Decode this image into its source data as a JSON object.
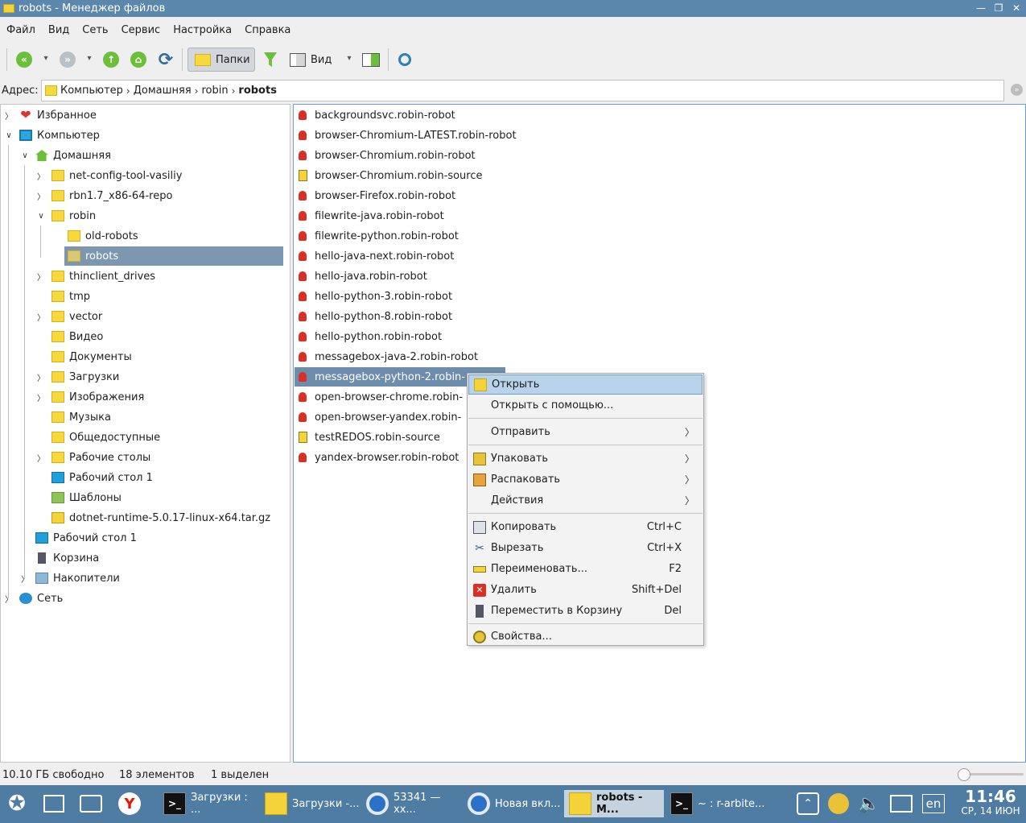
{
  "window": {
    "title": "robots - Менеджер файлов"
  },
  "menubar": [
    "Файл",
    "Вид",
    "Сеть",
    "Сервис",
    "Настройка",
    "Справка"
  ],
  "toolbar": {
    "folders_label": "Папки",
    "view_label": "Вид"
  },
  "address": {
    "label": "Адрес:",
    "crumbs": [
      "Компьютер",
      "Домашняя",
      "robin",
      "robots"
    ]
  },
  "tree": {
    "items": [
      {
        "label": "Избранное",
        "icon": "heart-icon"
      },
      {
        "label": "Компьютер",
        "icon": "monitor-icon"
      },
      {
        "label": "Домашняя",
        "icon": "home-icon"
      },
      {
        "label": "net-config-tool-vasiliy",
        "icon": "folder-icon"
      },
      {
        "label": "rbn1.7_x86-64-repo",
        "icon": "folder-icon"
      },
      {
        "label": "robin",
        "icon": "folder-icon"
      },
      {
        "label": "old-robots",
        "icon": "folder-icon"
      },
      {
        "label": "robots",
        "icon": "folder-icon"
      },
      {
        "label": "thinclient_drives",
        "icon": "folder-icon"
      },
      {
        "label": "tmp",
        "icon": "folder-icon"
      },
      {
        "label": "vector",
        "icon": "folder-icon"
      },
      {
        "label": "Видео",
        "icon": "video-folder-icon"
      },
      {
        "label": "Документы",
        "icon": "documents-folder-icon"
      },
      {
        "label": "Загрузки",
        "icon": "downloads-folder-icon"
      },
      {
        "label": "Изображения",
        "icon": "images-folder-icon"
      },
      {
        "label": "Музыка",
        "icon": "music-folder-icon"
      },
      {
        "label": "Общедоступные",
        "icon": "public-folder-icon"
      },
      {
        "label": "Рабочие столы",
        "icon": "folder-icon"
      },
      {
        "label": "Рабочий стол 1",
        "icon": "desktop-icon"
      },
      {
        "label": "Шаблоны",
        "icon": "templates-folder-icon"
      },
      {
        "label": "dotnet-runtime-5.0.17-linux-x64.tar.gz",
        "icon": "archive-icon"
      },
      {
        "label": "Рабочий стол 1",
        "icon": "desktop-icon"
      },
      {
        "label": "Корзина",
        "icon": "trash-icon"
      },
      {
        "label": "Накопители",
        "icon": "drives-icon"
      },
      {
        "label": "Сеть",
        "icon": "network-icon"
      }
    ]
  },
  "files": [
    {
      "name": "backgroundsvc.robin-robot",
      "icon": "robot-file-icon"
    },
    {
      "name": "browser-Chromium-LATEST.robin-robot",
      "icon": "robot-file-icon"
    },
    {
      "name": "browser-Chromium.robin-robot",
      "icon": "robot-file-icon"
    },
    {
      "name": "browser-Chromium.robin-source",
      "icon": "source-archive-icon"
    },
    {
      "name": "browser-Firefox.robin-robot",
      "icon": "robot-file-icon"
    },
    {
      "name": "filewrite-java.robin-robot",
      "icon": "robot-file-icon"
    },
    {
      "name": "filewrite-python.robin-robot",
      "icon": "robot-file-icon"
    },
    {
      "name": "hello-java-next.robin-robot",
      "icon": "robot-file-icon"
    },
    {
      "name": "hello-java.robin-robot",
      "icon": "robot-file-icon"
    },
    {
      "name": "hello-python-3.robin-robot",
      "icon": "robot-file-icon"
    },
    {
      "name": "hello-python-8.robin-robot",
      "icon": "robot-file-icon"
    },
    {
      "name": "hello-python.robin-robot",
      "icon": "robot-file-icon"
    },
    {
      "name": "messagebox-java-2.robin-robot",
      "icon": "robot-file-icon"
    },
    {
      "name": "messagebox-python-2.robin-",
      "icon": "robot-file-icon"
    },
    {
      "name": "open-browser-chrome.robin-",
      "icon": "robot-file-icon"
    },
    {
      "name": "open-browser-yandex.robin-",
      "icon": "robot-file-icon"
    },
    {
      "name": "testREDOS.robin-source",
      "icon": "source-archive-icon"
    },
    {
      "name": "yandex-browser.robin-robot",
      "icon": "robot-file-icon"
    }
  ],
  "context_menu": {
    "open": "Открыть",
    "open_with": "Открыть с помощью...",
    "send": "Отправить",
    "pack": "Упаковать",
    "unpack": "Распаковать",
    "actions": "Действия",
    "copy": "Копировать",
    "copy_sc": "Ctrl+C",
    "cut": "Вырезать",
    "cut_sc": "Ctrl+X",
    "rename": "Переименовать...",
    "rename_sc": "F2",
    "delete": "Удалить",
    "delete_sc": "Shift+Del",
    "trash": "Переместить в Корзину",
    "trash_sc": "Del",
    "properties": "Свойства..."
  },
  "status": {
    "free": "10.10 ГБ свободно",
    "count": "18 элементов",
    "selected": "1 выделен"
  },
  "taskbar": {
    "tasks": [
      {
        "label": "Загрузки : ...",
        "icon": "terminal-icon"
      },
      {
        "label": "Загрузки -...",
        "icon": "downloads-folder-icon"
      },
      {
        "label": "53341 — xx...",
        "icon": "chromium-icon"
      },
      {
        "label": "Новая вкл...",
        "icon": "chromium-icon"
      },
      {
        "label": "robots - М...",
        "icon": "folder-icon"
      },
      {
        "label": "~ : r-arbite...",
        "icon": "terminal-icon"
      }
    ],
    "lang": "en",
    "time": "11:46",
    "date": "СР, 14 ИЮН"
  }
}
